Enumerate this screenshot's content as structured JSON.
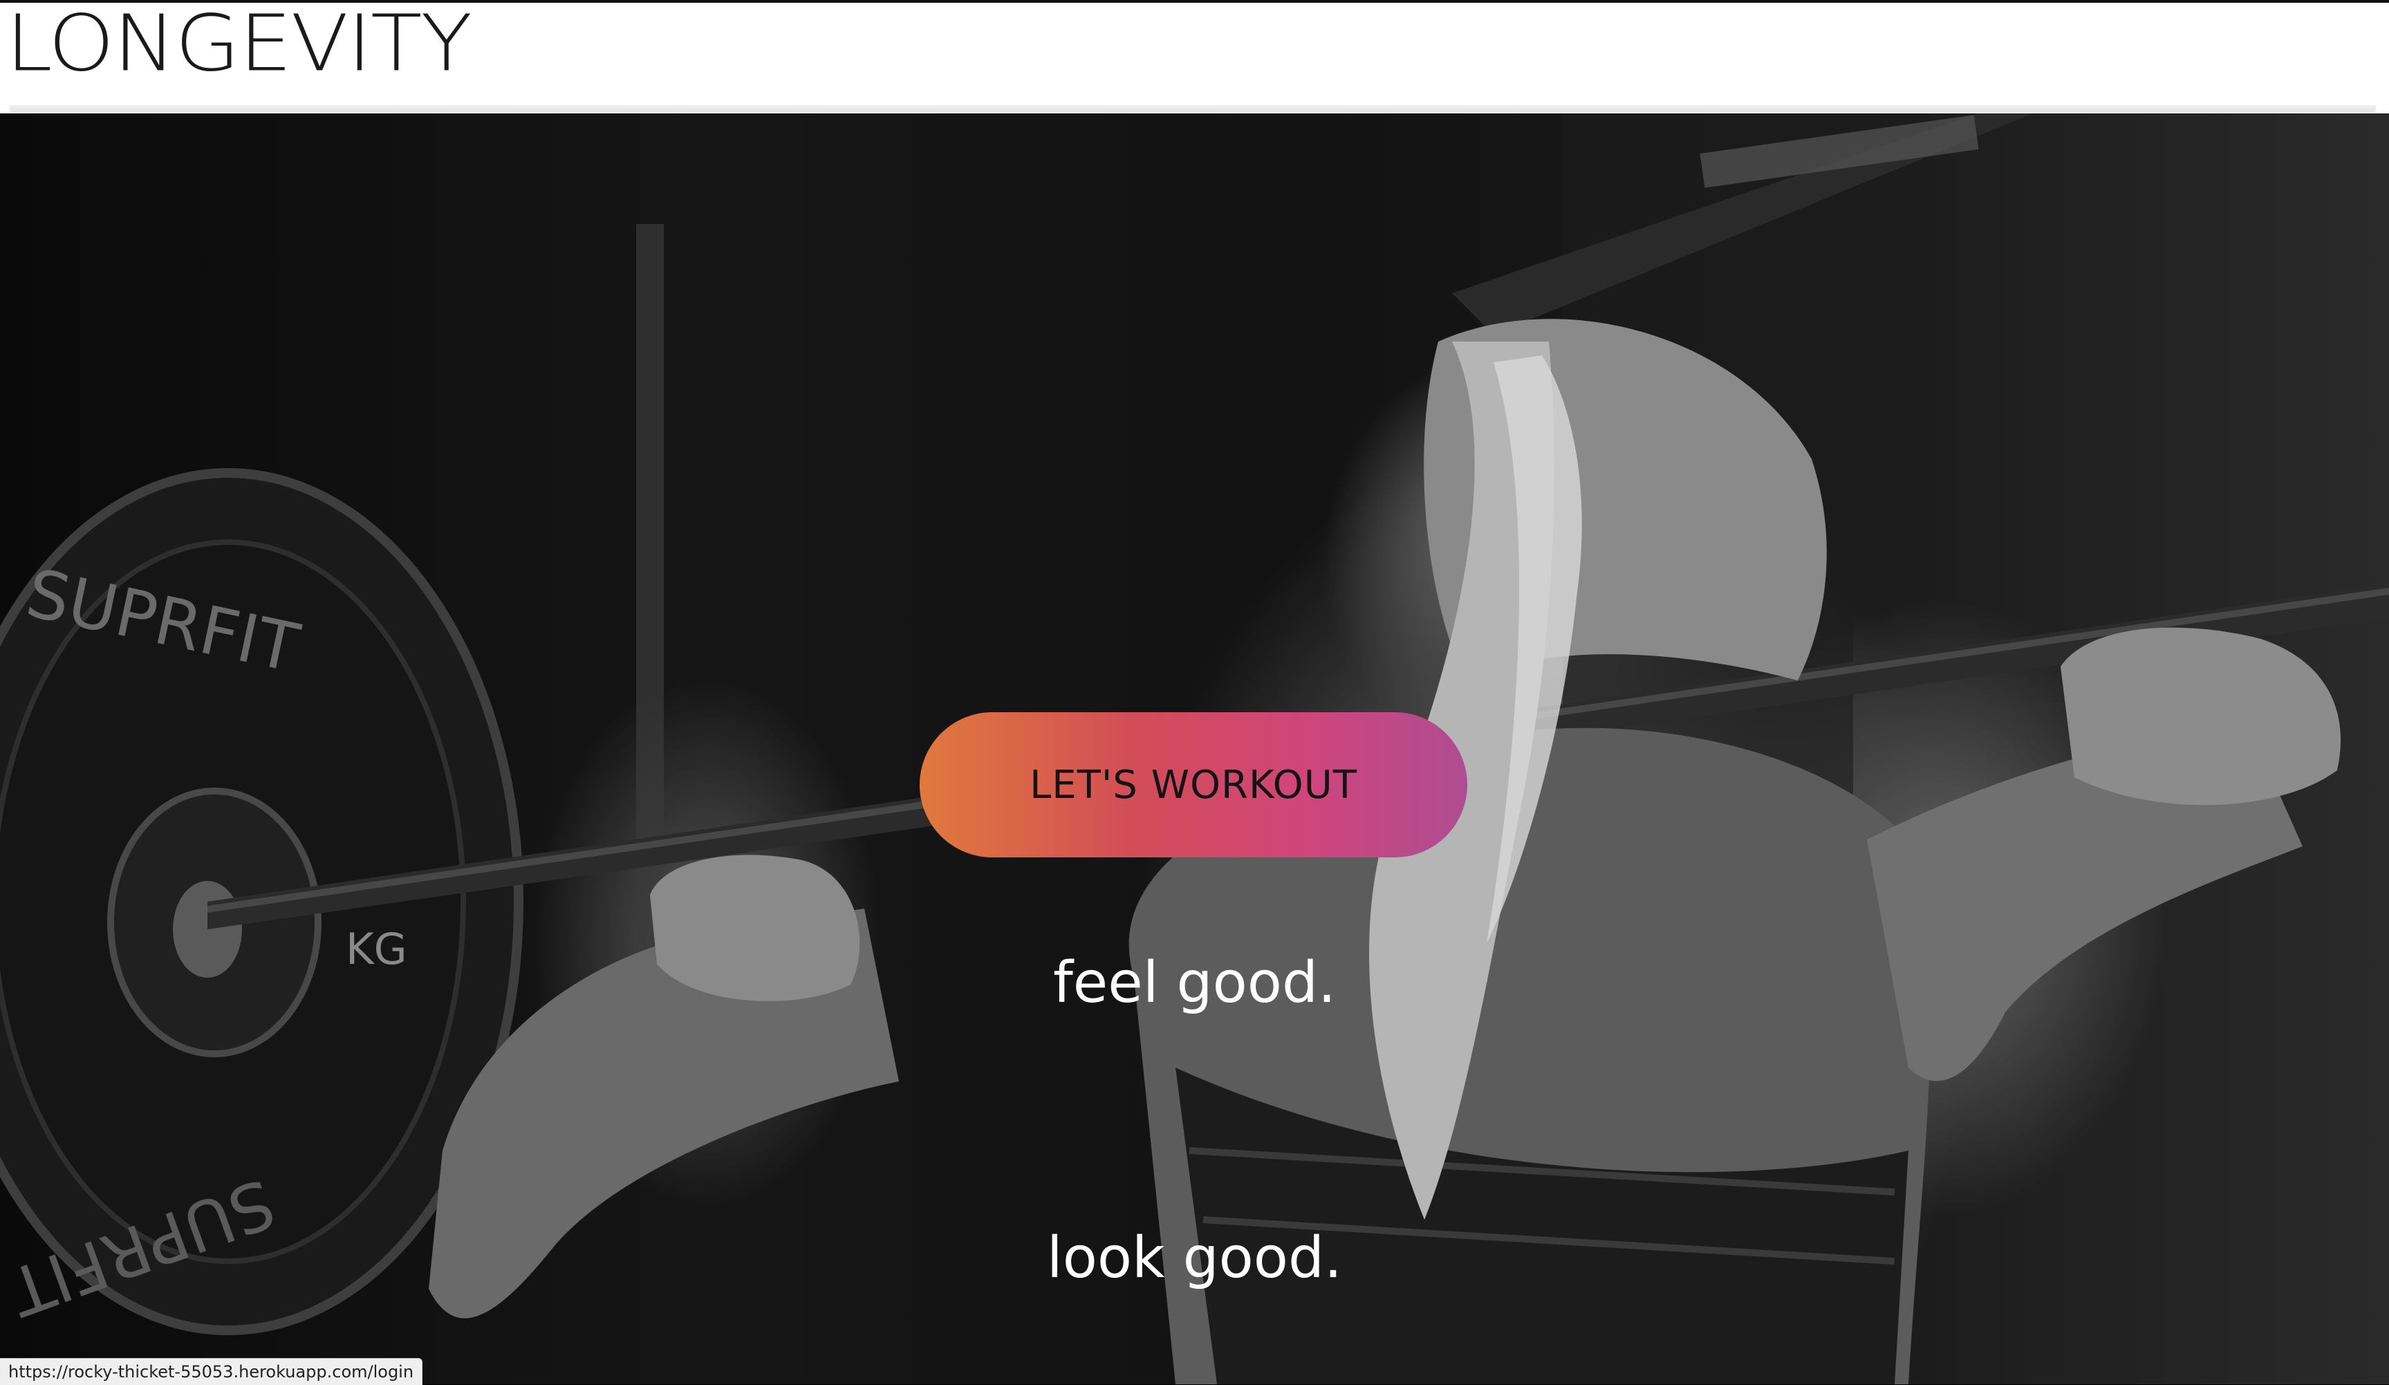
{
  "header": {
    "brand": "LONGEVITY"
  },
  "hero": {
    "image_icon": "barbell-squat-photo",
    "plate_text_1": "SUPRFIT",
    "plate_text_2": "KG",
    "plate_text_3": "SUPRFIT",
    "cta_label": "LET'S WORKOUT",
    "tagline_1": "feel good.",
    "tagline_2": "look good."
  },
  "status_bar": {
    "url": "https://rocky-thicket-55053.herokuapp.com/login"
  },
  "colors": {
    "cta_gradient_start": "#e0793d",
    "cta_gradient_mid": "#d24c58",
    "cta_gradient_end": "#ae4d92",
    "navbar_bg": "#ffffff",
    "tagline": "#ffffff"
  }
}
